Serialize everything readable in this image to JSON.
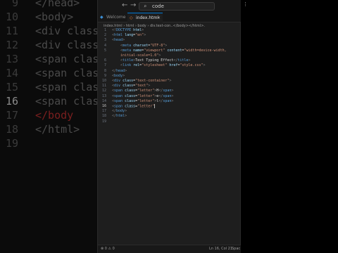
{
  "background": {
    "lines": [
      {
        "num": "9",
        "code": "</head>",
        "cls": "bg-tag"
      },
      {
        "num": "10",
        "code": "<body>",
        "cls": "bg-tag"
      },
      {
        "num": "11",
        "code": "<div class=",
        "cls": "bg-tag"
      },
      {
        "num": "12",
        "code": "<div class=",
        "cls": "bg-tag"
      },
      {
        "num": "13",
        "code": "<span class=",
        "cls": "bg-tag"
      },
      {
        "num": "14",
        "code": "<span class=",
        "cls": "bg-tag"
      },
      {
        "num": "15",
        "code": "<span class=",
        "cls": "bg-tag"
      },
      {
        "num": "16",
        "code": "<span class=",
        "cls": "bg-tag",
        "active": true
      },
      {
        "num": "17",
        "code": "</body",
        "cls": "bg-red"
      },
      {
        "num": "18",
        "code": "</html>",
        "cls": "bg-tag"
      },
      {
        "num": "19",
        "code": "",
        "cls": "bg-tag"
      }
    ]
  },
  "titlebar": {
    "search_text": "code",
    "back_icon": "arrow-left-icon",
    "forward_icon": "arrow-right-icon"
  },
  "tabs": [
    {
      "label": "Welcome",
      "active": false
    },
    {
      "label": "index.html",
      "active": true
    }
  ],
  "breadcrumb": "index.html › html › body › div.text-con..</body></html>.",
  "code_lines": [
    {
      "n": "1",
      "html": "<span class=\"p\">&lt;!</span><span class=\"t\">DOCTYPE</span> <span class=\"a\">html</span><span class=\"p\">&gt;</span>"
    },
    {
      "n": "2",
      "html": "<span class=\"p\">&lt;</span><span class=\"t\">html</span> <span class=\"a\">lang</span>=<span class=\"s\">\"en\"</span><span class=\"p\">&gt;</span>"
    },
    {
      "n": "3",
      "html": "<span class=\"p\">&lt;</span><span class=\"t\">head</span><span class=\"p\">&gt;</span>"
    },
    {
      "n": "4",
      "html": "    <span class=\"p\">&lt;</span><span class=\"t\">meta</span> <span class=\"a\">charset</span>=<span class=\"s\">\"UTF-8\"</span><span class=\"p\">&gt;</span>"
    },
    {
      "n": "5",
      "html": "    <span class=\"p\">&lt;</span><span class=\"t\">meta</span> <span class=\"a\">name</span>=<span class=\"s\">\"viewport\"</span> <span class=\"a\">content</span>=<span class=\"s\">\"width=device-width,</span>"
    },
    {
      "n": "",
      "html": "    <span class=\"s\">initial-scale=1.0\"</span><span class=\"p\">&gt;</span>"
    },
    {
      "n": "6",
      "html": "    <span class=\"p\">&lt;</span><span class=\"t\">title</span><span class=\"p\">&gt;</span><span class=\"w\">Text Typing Effect</span><span class=\"p\">&lt;/</span><span class=\"t\">title</span><span class=\"p\">&gt;</span>"
    },
    {
      "n": "7",
      "html": "    <span class=\"p\">&lt;</span><span class=\"t\">link</span> <span class=\"a\">rel</span>=<span class=\"s\">\"stylesheet\"</span> <span class=\"a\">href</span>=<span class=\"s\">\"style.css\"</span><span class=\"p\">&gt;</span>"
    },
    {
      "n": "8",
      "html": "<span class=\"p\">&lt;/</span><span class=\"t\">head</span><span class=\"p\">&gt;</span>"
    },
    {
      "n": "9",
      "html": "<span class=\"p\">&lt;</span><span class=\"t\">body</span><span class=\"p\">&gt;</span>"
    },
    {
      "n": "10",
      "html": "<span class=\"p\">&lt;</span><span class=\"t\">div</span> <span class=\"a\">class</span>=<span class=\"s\">\"text-container\"</span><span class=\"p\">&gt;</span>"
    },
    {
      "n": "11",
      "html": "<span class=\"p\">&lt;</span><span class=\"t\">div</span> <span class=\"a\">class</span>=<span class=\"s\">\"text\"</span><span class=\"p\">&gt;</span>"
    },
    {
      "n": "12",
      "html": "<span class=\"p\">&lt;</span><span class=\"t\">span</span> <span class=\"a\">class</span>=<span class=\"s\">\"letter\"</span><span class=\"p\">&gt;</span>H<span class=\"p\">&lt;/</span><span class=\"t\">span</span><span class=\"p\">&gt;</span>"
    },
    {
      "n": "13",
      "html": "<span class=\"p\">&lt;</span><span class=\"t\">span</span> <span class=\"a\">class</span>=<span class=\"s\">\"letter\"</span><span class=\"p\">&gt;</span>e<span class=\"p\">&lt;/</span><span class=\"t\">span</span><span class=\"p\">&gt;</span>"
    },
    {
      "n": "14",
      "html": "<span class=\"p\">&lt;</span><span class=\"t\">span</span> <span class=\"a\">class</span>=<span class=\"s\">\"letter\"</span><span class=\"p\">&gt;</span>l<span class=\"p\">&lt;/</span><span class=\"t\">span</span><span class=\"p\">&gt;</span>"
    },
    {
      "n": "16",
      "html": "<span class=\"p\">&lt;</span><span class=\"t\">span</span> <span class=\"a\">class</span>=<span class=\"s\">\"letter\"</span><span class=\"cursor\"></span>",
      "active": true
    },
    {
      "n": "17",
      "html": "<span class=\"p\">&lt;/</span><span class=\"t\">body</span><span class=\"p\">&gt;</span>"
    },
    {
      "n": "18",
      "html": "<span class=\"p\">&lt;/</span><span class=\"t\">html</span><span class=\"p\">&gt;</span>"
    },
    {
      "n": "19",
      "html": ""
    }
  ],
  "statusbar": {
    "left": "⊗ 0 ⚠ 0",
    "position": "Ln 16, Col 21",
    "spaces": "Spac"
  },
  "colors": {
    "editor_bg": "#1e1e1e",
    "tag": "#569cd6",
    "attr": "#9cdcfe",
    "string": "#ce9178",
    "accent": "#0078d4"
  }
}
